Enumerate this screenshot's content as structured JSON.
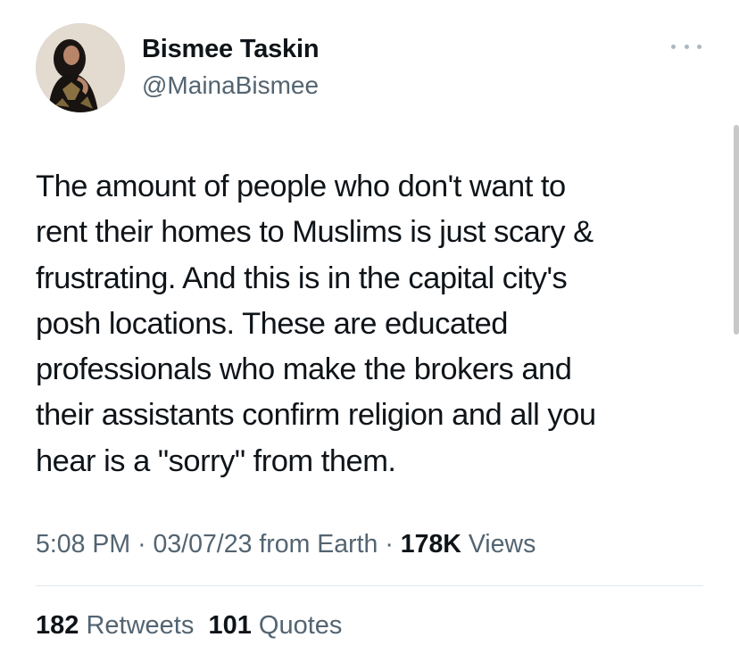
{
  "author": {
    "display_name": "Bismee Taskin",
    "handle": "@MainaBismee"
  },
  "tweet": {
    "lines": [
      "The amount of people who don't want to",
      "rent their homes to Muslims is just scary &",
      "frustrating. And this is in the capital city's",
      "posh locations. These are educated",
      "professionals who make the brokers and",
      "their assistants confirm religion and all you",
      "hear is a \"sorry\" from them."
    ]
  },
  "meta": {
    "time": "5:08 PM",
    "sep1": "·",
    "date": "03/07/23",
    "source": "from Earth",
    "sep2": "·",
    "views_count": "178K",
    "views_label": "Views"
  },
  "stats": {
    "retweets_count": "182",
    "retweets_label": "Retweets",
    "quotes_count": "101",
    "quotes_label": "Quotes"
  },
  "icons": {
    "more": "more-horizontal-icon"
  },
  "colors": {
    "primary_text": "#0f1419",
    "secondary_text": "#536471",
    "divider": "#e1e8ed"
  }
}
